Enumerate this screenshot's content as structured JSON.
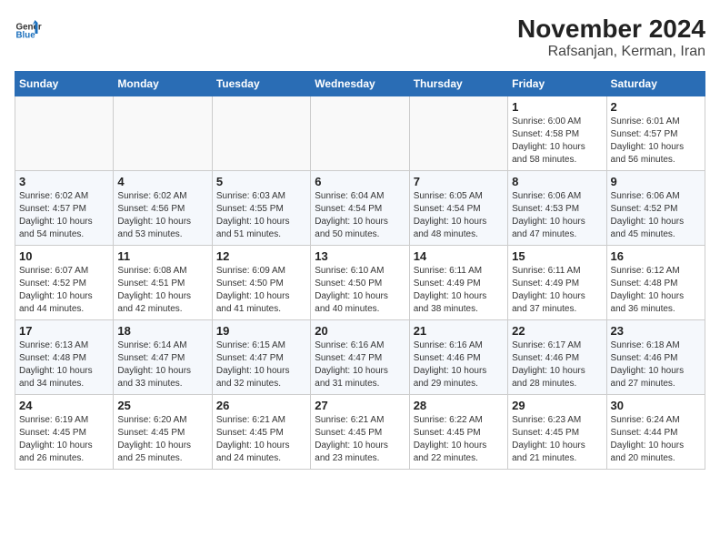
{
  "header": {
    "logo_general": "General",
    "logo_blue": "Blue",
    "title": "November 2024",
    "subtitle": "Rafsanjan, Kerman, Iran"
  },
  "weekdays": [
    "Sunday",
    "Monday",
    "Tuesday",
    "Wednesday",
    "Thursday",
    "Friday",
    "Saturday"
  ],
  "rows": [
    [
      {
        "day": "",
        "info": ""
      },
      {
        "day": "",
        "info": ""
      },
      {
        "day": "",
        "info": ""
      },
      {
        "day": "",
        "info": ""
      },
      {
        "day": "",
        "info": ""
      },
      {
        "day": "1",
        "info": "Sunrise: 6:00 AM\nSunset: 4:58 PM\nDaylight: 10 hours\nand 58 minutes."
      },
      {
        "day": "2",
        "info": "Sunrise: 6:01 AM\nSunset: 4:57 PM\nDaylight: 10 hours\nand 56 minutes."
      }
    ],
    [
      {
        "day": "3",
        "info": "Sunrise: 6:02 AM\nSunset: 4:57 PM\nDaylight: 10 hours\nand 54 minutes."
      },
      {
        "day": "4",
        "info": "Sunrise: 6:02 AM\nSunset: 4:56 PM\nDaylight: 10 hours\nand 53 minutes."
      },
      {
        "day": "5",
        "info": "Sunrise: 6:03 AM\nSunset: 4:55 PM\nDaylight: 10 hours\nand 51 minutes."
      },
      {
        "day": "6",
        "info": "Sunrise: 6:04 AM\nSunset: 4:54 PM\nDaylight: 10 hours\nand 50 minutes."
      },
      {
        "day": "7",
        "info": "Sunrise: 6:05 AM\nSunset: 4:54 PM\nDaylight: 10 hours\nand 48 minutes."
      },
      {
        "day": "8",
        "info": "Sunrise: 6:06 AM\nSunset: 4:53 PM\nDaylight: 10 hours\nand 47 minutes."
      },
      {
        "day": "9",
        "info": "Sunrise: 6:06 AM\nSunset: 4:52 PM\nDaylight: 10 hours\nand 45 minutes."
      }
    ],
    [
      {
        "day": "10",
        "info": "Sunrise: 6:07 AM\nSunset: 4:52 PM\nDaylight: 10 hours\nand 44 minutes."
      },
      {
        "day": "11",
        "info": "Sunrise: 6:08 AM\nSunset: 4:51 PM\nDaylight: 10 hours\nand 42 minutes."
      },
      {
        "day": "12",
        "info": "Sunrise: 6:09 AM\nSunset: 4:50 PM\nDaylight: 10 hours\nand 41 minutes."
      },
      {
        "day": "13",
        "info": "Sunrise: 6:10 AM\nSunset: 4:50 PM\nDaylight: 10 hours\nand 40 minutes."
      },
      {
        "day": "14",
        "info": "Sunrise: 6:11 AM\nSunset: 4:49 PM\nDaylight: 10 hours\nand 38 minutes."
      },
      {
        "day": "15",
        "info": "Sunrise: 6:11 AM\nSunset: 4:49 PM\nDaylight: 10 hours\nand 37 minutes."
      },
      {
        "day": "16",
        "info": "Sunrise: 6:12 AM\nSunset: 4:48 PM\nDaylight: 10 hours\nand 36 minutes."
      }
    ],
    [
      {
        "day": "17",
        "info": "Sunrise: 6:13 AM\nSunset: 4:48 PM\nDaylight: 10 hours\nand 34 minutes."
      },
      {
        "day": "18",
        "info": "Sunrise: 6:14 AM\nSunset: 4:47 PM\nDaylight: 10 hours\nand 33 minutes."
      },
      {
        "day": "19",
        "info": "Sunrise: 6:15 AM\nSunset: 4:47 PM\nDaylight: 10 hours\nand 32 minutes."
      },
      {
        "day": "20",
        "info": "Sunrise: 6:16 AM\nSunset: 4:47 PM\nDaylight: 10 hours\nand 31 minutes."
      },
      {
        "day": "21",
        "info": "Sunrise: 6:16 AM\nSunset: 4:46 PM\nDaylight: 10 hours\nand 29 minutes."
      },
      {
        "day": "22",
        "info": "Sunrise: 6:17 AM\nSunset: 4:46 PM\nDaylight: 10 hours\nand 28 minutes."
      },
      {
        "day": "23",
        "info": "Sunrise: 6:18 AM\nSunset: 4:46 PM\nDaylight: 10 hours\nand 27 minutes."
      }
    ],
    [
      {
        "day": "24",
        "info": "Sunrise: 6:19 AM\nSunset: 4:45 PM\nDaylight: 10 hours\nand 26 minutes."
      },
      {
        "day": "25",
        "info": "Sunrise: 6:20 AM\nSunset: 4:45 PM\nDaylight: 10 hours\nand 25 minutes."
      },
      {
        "day": "26",
        "info": "Sunrise: 6:21 AM\nSunset: 4:45 PM\nDaylight: 10 hours\nand 24 minutes."
      },
      {
        "day": "27",
        "info": "Sunrise: 6:21 AM\nSunset: 4:45 PM\nDaylight: 10 hours\nand 23 minutes."
      },
      {
        "day": "28",
        "info": "Sunrise: 6:22 AM\nSunset: 4:45 PM\nDaylight: 10 hours\nand 22 minutes."
      },
      {
        "day": "29",
        "info": "Sunrise: 6:23 AM\nSunset: 4:45 PM\nDaylight: 10 hours\nand 21 minutes."
      },
      {
        "day": "30",
        "info": "Sunrise: 6:24 AM\nSunset: 4:44 PM\nDaylight: 10 hours\nand 20 minutes."
      }
    ]
  ]
}
